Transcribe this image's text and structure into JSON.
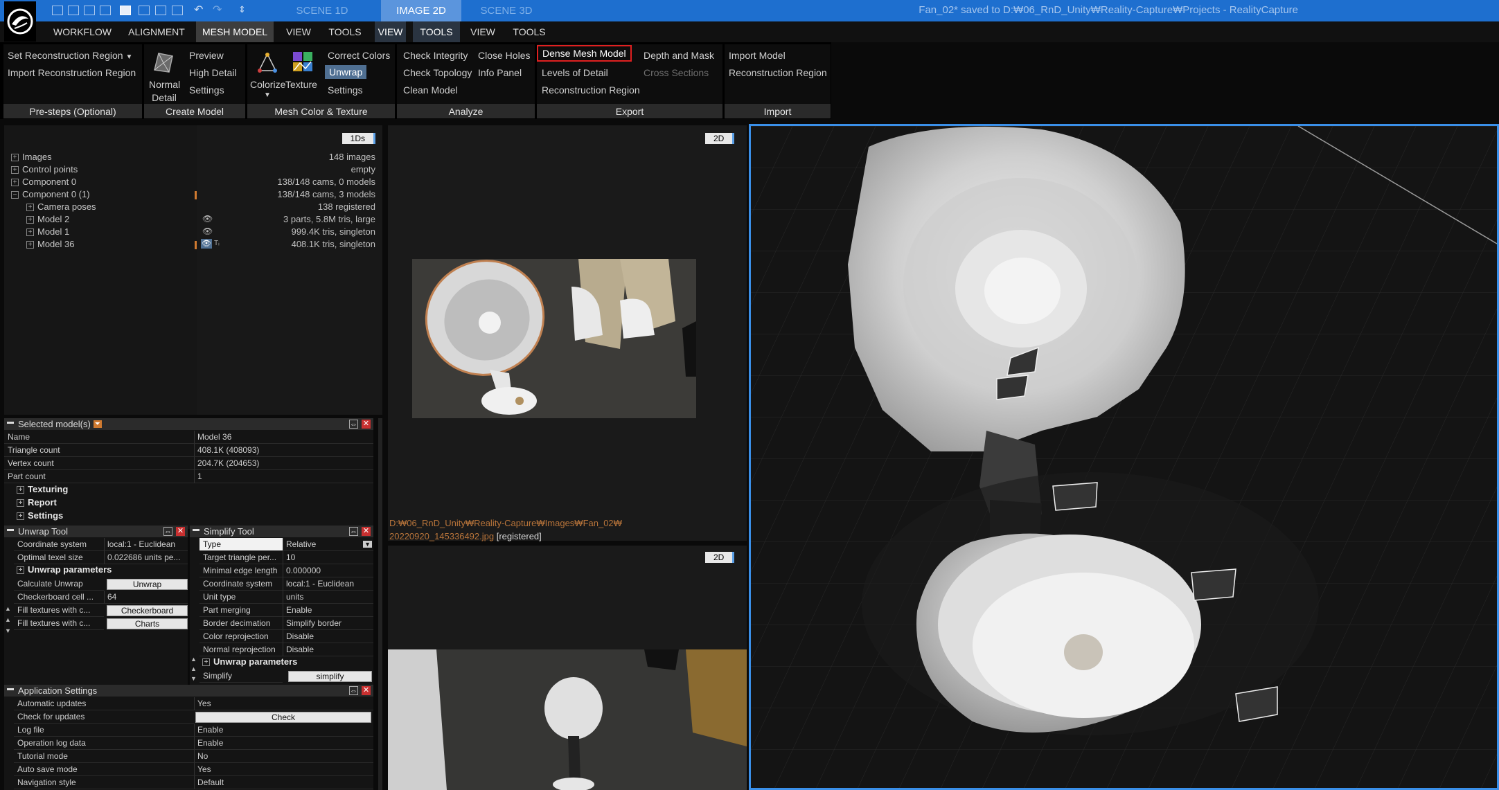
{
  "app": {
    "title": "Fan_02* saved to D:₩06_RnD_Unity₩Reality-Capture₩Projects - RealityCapture"
  },
  "scene_tabs": [
    "SCENE 1D",
    "IMAGE 2D",
    "SCENE 3D"
  ],
  "menu": [
    "WORKFLOW",
    "ALIGNMENT",
    "MESH MODEL",
    "VIEW",
    "TOOLS",
    "VIEW",
    "TOOLS",
    "VIEW",
    "TOOLS"
  ],
  "ribbon": {
    "presteps": {
      "label": "Pre-steps (Optional)",
      "set_region": "Set Reconstruction Region",
      "import_region": "Import Reconstruction Region"
    },
    "create_model": {
      "label": "Create Model",
      "normal_detail_1": "Normal",
      "normal_detail_2": "Detail",
      "preview": "Preview",
      "high_detail": "High Detail",
      "settings": "Settings"
    },
    "color_texture": {
      "label": "Mesh Color & Texture",
      "colorize": "Colorize",
      "texture": "Texture",
      "correct_colors": "Correct Colors",
      "unwrap": "Unwrap",
      "settings": "Settings"
    },
    "analyze": {
      "label": "Analyze",
      "check_integrity": "Check Integrity",
      "check_topology": "Check Topology",
      "clean_model": "Clean Model",
      "close_holes": "Close Holes",
      "info_panel": "Info Panel"
    },
    "export": {
      "label": "Export",
      "dense_mesh": "Dense Mesh Model",
      "levels_of_detail": "Levels of Detail",
      "reconstruction_region": "Reconstruction Region",
      "depth_mask": "Depth and Mask",
      "cross_sections": "Cross Sections"
    },
    "import": {
      "label": "Import",
      "import_model": "Import Model",
      "reconstruction_region": "Reconstruction Region"
    }
  },
  "tree": {
    "tag": "1Ds",
    "rows": [
      {
        "label": "Images",
        "value": "148 images"
      },
      {
        "label": "Control points",
        "value": "empty"
      },
      {
        "label": "Component 0",
        "value": "138/148 cams, 0 models"
      },
      {
        "label": "Component 0 (1)",
        "value": "138/148 cams, 3 models"
      },
      {
        "label": "Camera poses",
        "value": "138 registered"
      },
      {
        "label": "Model 2",
        "value": "3 parts, 5.8M tris, large"
      },
      {
        "label": "Model 1",
        "value": "999.4K tris, singleton"
      },
      {
        "label": "Model 36",
        "value": "408.1K tris, singleton"
      }
    ]
  },
  "image_view": {
    "tag": "2D",
    "path_line1": "D:₩06_RnD_Unity₩Reality-Capture₩Images₩Fan_02₩",
    "path_line2": "20220920_145336492.jpg",
    "status": "[registered]",
    "tag2": "2D"
  },
  "selected_models": {
    "title": "Selected model(s)",
    "rows": [
      {
        "label": "Name",
        "value": "Model 36"
      },
      {
        "label": "Triangle count",
        "value": "408.1K (408093)"
      },
      {
        "label": "Vertex count",
        "value": "204.7K (204653)"
      },
      {
        "label": "Part count",
        "value": "1"
      }
    ],
    "sections": [
      "Texturing",
      "Report",
      "Settings"
    ]
  },
  "unwrap_tool": {
    "title": "Unwrap Tool",
    "rows": [
      {
        "label": "Coordinate system",
        "value": "local:1 - Euclidean"
      },
      {
        "label": "Optimal texel size",
        "value": "0.022686 units pe..."
      }
    ],
    "params_title": "Unwrap parameters",
    "calc_label": "Calculate Unwrap",
    "calc_btn": "Unwrap",
    "cell_label": "Checkerboard cell ...",
    "cell_value": "64",
    "fill1_label": "Fill textures with c...",
    "fill1_btn": "Checkerboard",
    "fill2_label": "Fill textures with c...",
    "fill2_btn": "Charts"
  },
  "simplify_tool": {
    "title": "Simplify Tool",
    "rows": [
      {
        "label": "Type",
        "value": "Relative"
      },
      {
        "label": "Target triangle per...",
        "value": "10"
      },
      {
        "label": "Minimal edge length",
        "value": "0.000000"
      },
      {
        "label": "Coordinate system",
        "value": "local:1 - Euclidean"
      },
      {
        "label": "Unit type",
        "value": "units"
      },
      {
        "label": "Part merging",
        "value": "Enable"
      },
      {
        "label": "Border decimation",
        "value": "Simplify border"
      },
      {
        "label": "Color reprojection",
        "value": "Disable"
      },
      {
        "label": "Normal reprojection",
        "value": "Disable"
      }
    ],
    "params_title": "Unwrap parameters",
    "simplify_label": "Simplify",
    "simplify_btn": "simplify"
  },
  "app_settings": {
    "title": "Application Settings",
    "rows": [
      {
        "label": "Automatic updates",
        "value": "Yes"
      },
      {
        "label": "Check for updates",
        "value": "Check"
      },
      {
        "label": "Log file",
        "value": "Enable"
      },
      {
        "label": "Operation log data",
        "value": "Enable"
      },
      {
        "label": "Tutorial mode",
        "value": "No"
      },
      {
        "label": "Auto save mode",
        "value": "Yes"
      },
      {
        "label": "Navigation style",
        "value": "Default"
      }
    ]
  },
  "colors": {
    "accent": "#1e6fcf",
    "active_tab": "#5b95dd",
    "highlight_border": "#e02020",
    "viewport_border": "#3a8fe8",
    "path_text": "#b8743a"
  }
}
